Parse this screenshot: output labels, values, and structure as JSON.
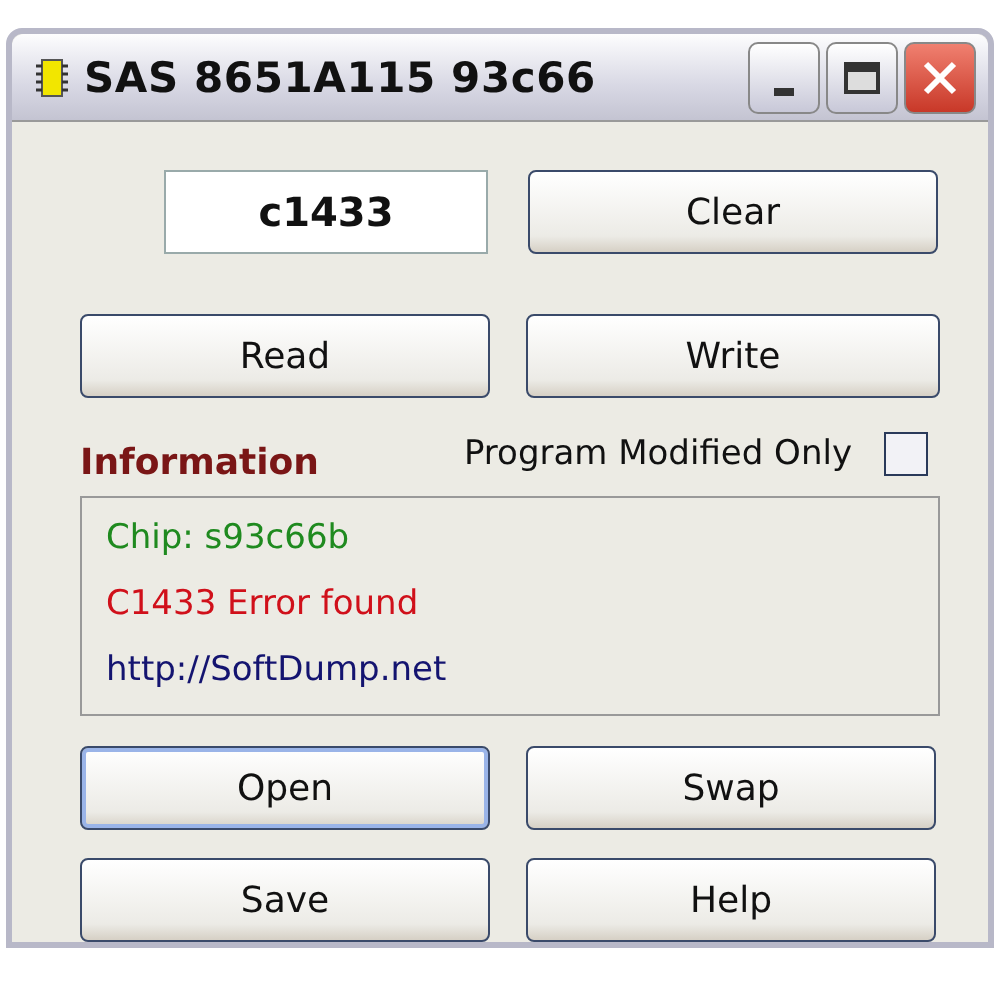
{
  "window": {
    "title": "SAS 8651A115 93c66"
  },
  "code_field": {
    "value": "c1433"
  },
  "top_buttons": [
    {
      "label": "Clear",
      "focused": false
    }
  ],
  "rw_buttons": [
    {
      "label": "Read",
      "focused": false
    },
    {
      "label": "Write",
      "focused": false
    }
  ],
  "information": {
    "label": "Information",
    "checkbox": {
      "label": "Program Modified Only",
      "checked": false
    },
    "lines": [
      {
        "text": "Chip: s93c66b",
        "color": "#1f8a1f"
      },
      {
        "text": "C1433 Error found",
        "color": "#d0101a"
      },
      {
        "text": "http://SoftDump.net",
        "color": "#141470"
      }
    ]
  },
  "bottom_buttons": [
    {
      "label": "Open",
      "focused": true
    },
    {
      "label": "Swap",
      "focused": false
    },
    {
      "label": "Save",
      "focused": false
    },
    {
      "label": "Help",
      "focused": false
    }
  ]
}
